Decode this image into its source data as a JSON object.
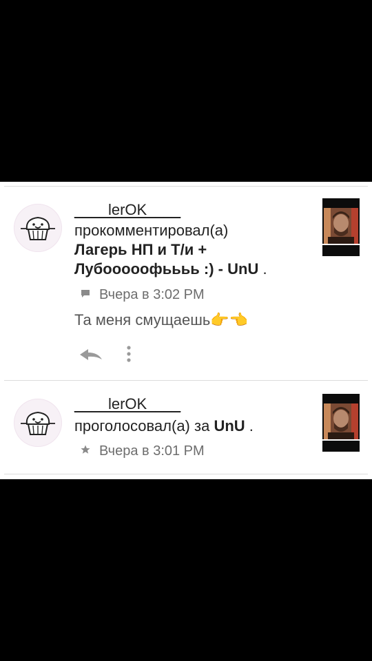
{
  "feed": {
    "items": [
      {
        "username": "____lerOK____",
        "action": "прокомментировал(а)",
        "story_title_line1": "Лагерь НП и Т/и +",
        "story_title_line2": "Лубооооофьььь :) - UnU",
        "trailing": ".",
        "meta_icon": "comment-icon",
        "time": "Вчера в 3:02 PM",
        "comment_text": "Та меня смущаешь",
        "comment_emoji": "👉👈",
        "reply_icon": "reply-icon",
        "more_icon": "more-vertical-icon"
      },
      {
        "username": "____lerOK____",
        "action": "проголосовал(а) за",
        "story_title": "UnU",
        "trailing": ".",
        "meta_icon": "star-icon",
        "time": "Вчера в 3:01 PM"
      }
    ]
  },
  "colors": {
    "background": "#000000",
    "panel": "#ffffff",
    "text": "#222222",
    "muted": "#6d6d6d",
    "divider": "#dcdcdc"
  }
}
